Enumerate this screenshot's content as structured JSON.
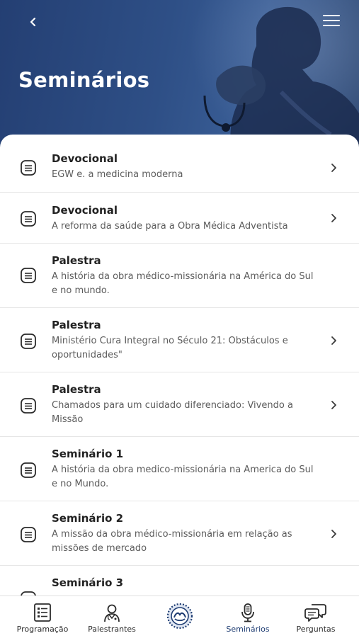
{
  "header": {
    "title": "Seminários",
    "back_icon": "chevron-left-icon",
    "menu_icon": "hamburger-menu-icon"
  },
  "sessions": [
    {
      "title": "Devocional",
      "subtitle": [
        "EGW e. a medicina moderna"
      ],
      "chevron": true
    },
    {
      "title": "Devocional",
      "subtitle": [
        "A reforma da saúde para a Obra Médica Adventista"
      ],
      "chevron": true
    },
    {
      "title": "Palestra",
      "subtitle": [
        "A história da obra médico-missionária na América do Sul",
        "e no mundo."
      ],
      "chevron": false
    },
    {
      "title": "Palestra",
      "subtitle": [
        "Ministério Cura Integral no Século 21: Obstáculos e",
        "oportunidades\""
      ],
      "chevron": true
    },
    {
      "title": "Palestra",
      "subtitle": [
        "Chamados para um cuidado diferenciado: Vivendo a",
        "Missão"
      ],
      "chevron": true
    },
    {
      "title": "Seminário 1",
      "subtitle": [
        "A história da obra medico-missionária na America do Sul",
        "e no Mundo."
      ],
      "chevron": false
    },
    {
      "title": "Seminário 2",
      "subtitle": [
        "A missão da obra médico-missionária em relação as",
        "missões de mercado"
      ],
      "chevron": true
    },
    {
      "title": "Seminário 3",
      "subtitle": [],
      "chevron": false
    }
  ],
  "tabbar": {
    "items": [
      {
        "label": "Programação",
        "icon": "checklist-icon"
      },
      {
        "label": "Palestrantes",
        "icon": "doctor-icon"
      },
      {
        "label": "",
        "icon": "event-logo-icon"
      },
      {
        "label": "Seminários",
        "icon": "microphone-icon"
      },
      {
        "label": "Perguntas",
        "icon": "chat-bubbles-icon"
      }
    ],
    "active": "Seminários"
  },
  "colors": {
    "header_bg": "#2e4f86",
    "accent": "#1e3c72",
    "text_primary": "#222222",
    "text_secondary": "#5c5c5c"
  }
}
